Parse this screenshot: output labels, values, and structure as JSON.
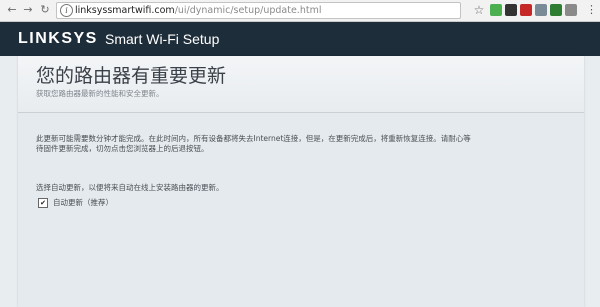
{
  "browser": {
    "url_host": "linksyssmartwifi.com",
    "url_path": "/ui/dynamic/setup/update.html",
    "icons": {
      "back": "back-arrow-icon",
      "forward": "forward-arrow-icon",
      "reload": "reload-icon",
      "info": "page-info-icon",
      "bookmark": "star-icon",
      "menu": "menu-icon"
    },
    "extensions": [
      {
        "name": "extension-green-icon",
        "color": "#4caf50"
      },
      {
        "name": "extension-dark-icon",
        "color": "#333333"
      },
      {
        "name": "extension-shield-icon",
        "color": "#c62828"
      },
      {
        "name": "extension-grey-icon",
        "color": "#7a8a96"
      },
      {
        "name": "extension-green-square-icon",
        "color": "#2e7d32"
      },
      {
        "name": "extension-gear-icon",
        "color": "#8a8a8a"
      }
    ]
  },
  "header": {
    "brand": "LINKSYS",
    "app_title": "Smart Wi-Fi Setup",
    "background": "#1e2d3a"
  },
  "page": {
    "title": "您的路由器有重要更新",
    "subtitle": "获取您路由器最新的性能和安全更新。",
    "body": "此更新可能需要数分钟才能完成。在此时间内，所有设备都将失去Internet连接，但是，在更新完成后，将重新恢复连接。请耐心等待固件更新完成，切勿点击您浏览器上的后退按钮。",
    "auto_update_line": "选择自动更新，以便将来自动在线上安装路由器的更新。",
    "checkbox": {
      "checked": true,
      "label": "自动更新（推荐）"
    }
  }
}
